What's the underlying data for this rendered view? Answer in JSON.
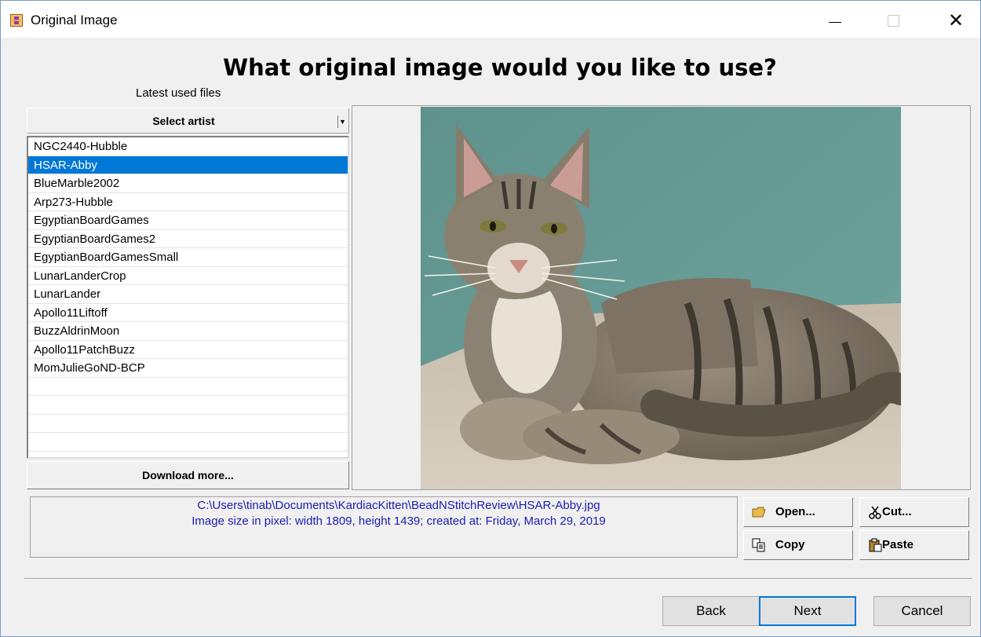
{
  "window": {
    "title": "Original Image",
    "app_icon": "bead-app-icon"
  },
  "heading": "What original image would you like to use?",
  "latest_label": "Latest used files",
  "artist_select": {
    "label": "Select artist"
  },
  "files": [
    "NGC2440-Hubble",
    "HSAR-Abby",
    "BlueMarble2002",
    "Arp273-Hubble",
    "EgyptianBoardGames",
    "EgyptianBoardGames2",
    "EgyptianBoardGamesSmall",
    "LunarLanderCrop",
    "LunarLander",
    "Apollo11Liftoff",
    "BuzzAldrinMoon",
    "Apollo11PatchBuzz",
    "MomJulieGoND-BCP",
    "",
    "",
    "",
    ""
  ],
  "selected_file": "HSAR-Abby",
  "download_label": "Download more...",
  "info": {
    "path": "C:\\Users\\tinab\\Documents\\KardiacKitten\\BeadNStitchReview\\HSAR-Abby.jpg",
    "size_line": "Image size in pixel: width 1809, height 1439; created at: Friday, March 29, 2019"
  },
  "tools": {
    "open": "Open...",
    "cut": "Cut...",
    "copy": "Copy",
    "paste": "Paste"
  },
  "nav": {
    "back": "Back",
    "next": "Next",
    "cancel": "Cancel"
  },
  "colors": {
    "selection": "#0078d7",
    "info_text": "#1c1cb4",
    "focus_border": "#0078d7"
  }
}
